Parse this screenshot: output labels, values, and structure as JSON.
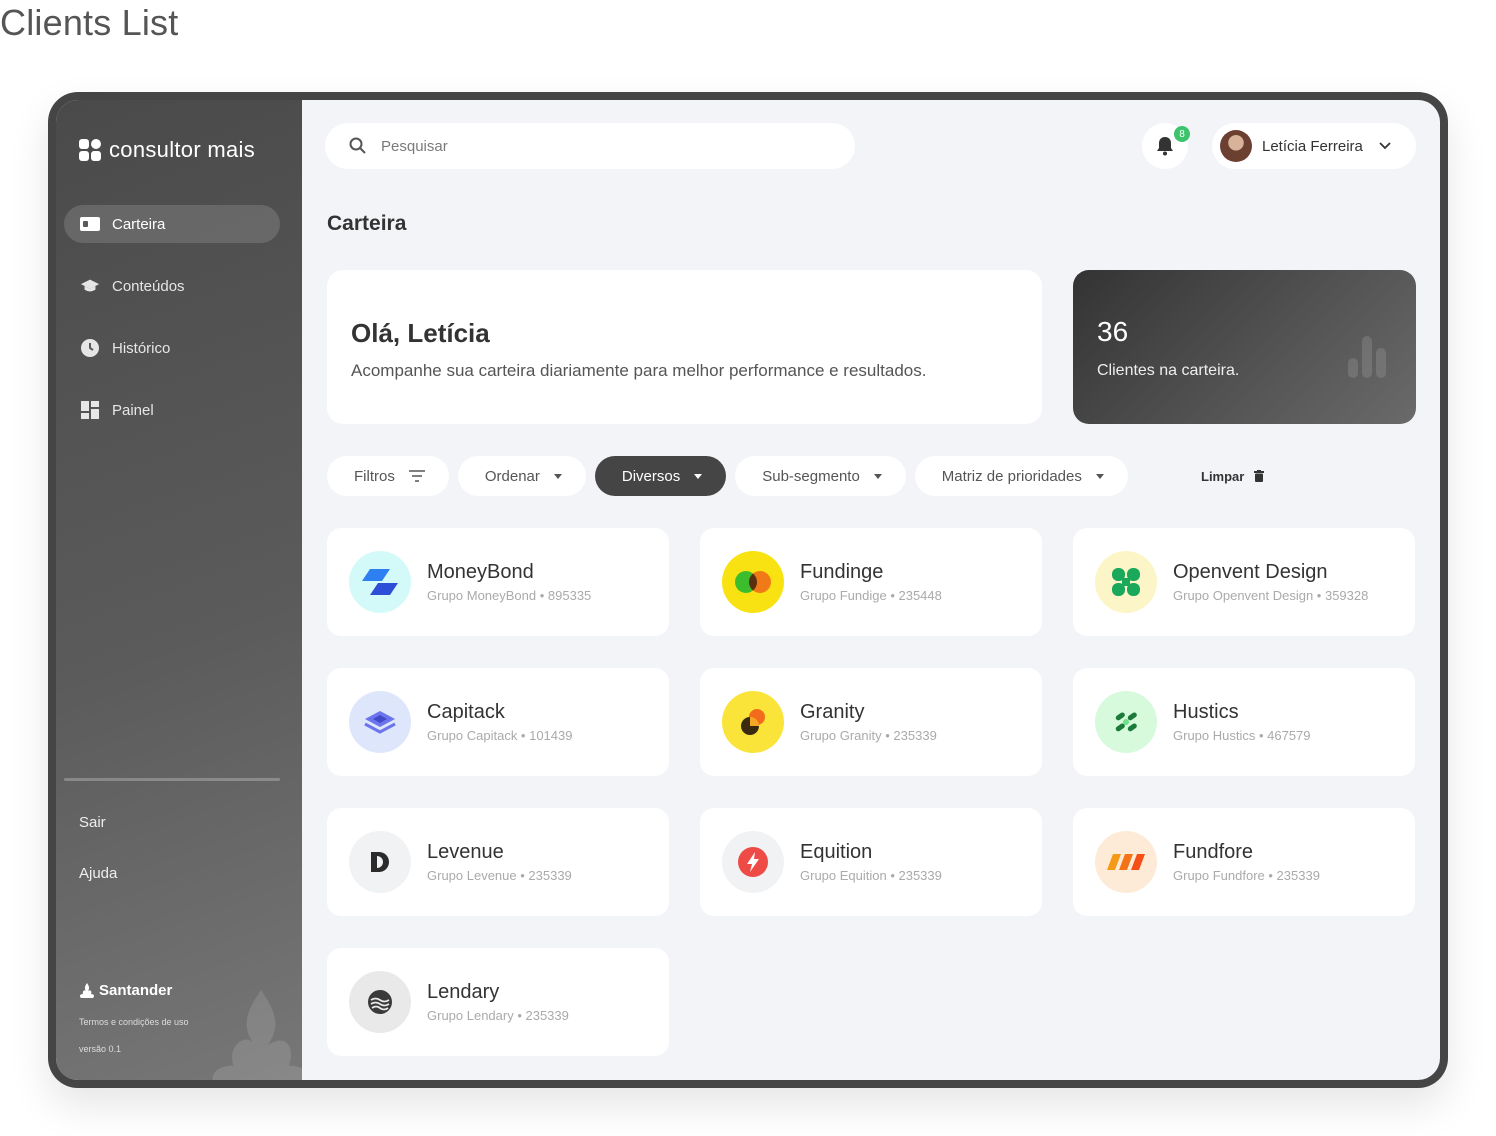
{
  "page_heading": "Clients List",
  "app": {
    "name": "consultor mais"
  },
  "sidebar": {
    "items": [
      {
        "label": "Carteira",
        "icon": "wallet-icon",
        "active": true
      },
      {
        "label": "Conteúdos",
        "icon": "graduation-cap-icon",
        "active": false
      },
      {
        "label": "Histórico",
        "icon": "clock-icon",
        "active": false
      },
      {
        "label": "Painel",
        "icon": "dashboard-icon",
        "active": false
      }
    ],
    "sair": "Sair",
    "ajuda": "Ajuda",
    "brand": "Santander",
    "terms": "Termos e condições de uso",
    "version": "versão 0.1"
  },
  "header": {
    "search_placeholder": "Pesquisar",
    "notifications_count": "8",
    "user_name": "Letícia Ferreira"
  },
  "main": {
    "title": "Carteira",
    "welcome": {
      "greeting": "Olá, Letícia",
      "text": "Acompanhe sua carteira diariamente para melhor performance e resultados."
    },
    "stats": {
      "value": "36",
      "label": "Clientes na carteira."
    },
    "filters": {
      "filtros": "Filtros",
      "ordenar": "Ordenar",
      "diversos": "Diversos",
      "subsegmento": "Sub-segmento",
      "matriz": "Matriz de prioridades",
      "limpar": "Limpar"
    }
  },
  "clients": [
    {
      "name": "MoneyBond",
      "sub": "Grupo MoneyBond • 895335",
      "bg": "#d3faf9"
    },
    {
      "name": "Fundinge",
      "sub": "Grupo Fundige • 235448",
      "bg": "#f9e211"
    },
    {
      "name": "Openvent Design",
      "sub": "Grupo Openvent Design • 359328",
      "bg": "#fcf5c8"
    },
    {
      "name": "Capitack",
      "sub": "Grupo Capitack • 101439",
      "bg": "#dde6fb"
    },
    {
      "name": "Granity",
      "sub": "Grupo Granity • 235339",
      "bg": "#fbe43a"
    },
    {
      "name": "Hustics",
      "sub": "Grupo Hustics • 467579",
      "bg": "#d6fadb"
    },
    {
      "name": "Levenue",
      "sub": "Grupo Levenue • 235339",
      "bg": "#f1f2f4"
    },
    {
      "name": "Equition",
      "sub": "Grupo Equition • 235339",
      "bg": "#f1f2f4"
    },
    {
      "name": "Fundfore",
      "sub": "Grupo Fundfore • 235339",
      "bg": "#fdebd7"
    },
    {
      "name": "Lendary",
      "sub": "Grupo Lendary • 235339",
      "bg": "#e9e9e9"
    }
  ]
}
